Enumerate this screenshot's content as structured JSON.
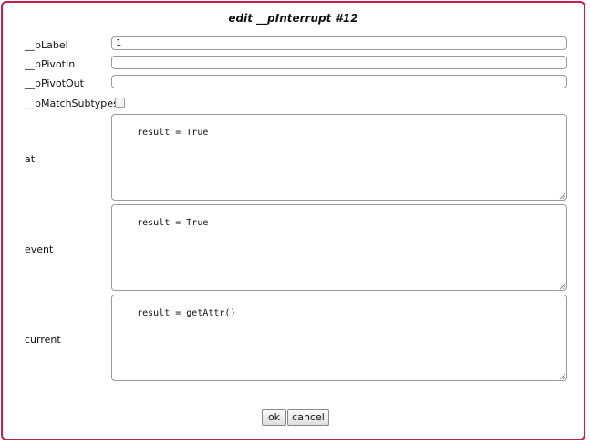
{
  "dialog": {
    "title": "edit __pInterrupt #12"
  },
  "fields": {
    "plabel": {
      "label": "__pLabel",
      "value": "1"
    },
    "ppivotin": {
      "label": "__pPivotIn",
      "value": ""
    },
    "ppivotout": {
      "label": "__pPivotOut",
      "value": ""
    },
    "pmatchsubtypes": {
      "label": "__pMatchSubtypes",
      "checked": false
    },
    "at": {
      "label": "at",
      "value": "result = True"
    },
    "event": {
      "label": "event",
      "value": "result = True"
    },
    "current": {
      "label": "current",
      "value": "result = getAttr()"
    }
  },
  "buttons": {
    "ok": "ok",
    "cancel": "cancel"
  },
  "colors": {
    "border_accent": "#c41e4a"
  }
}
